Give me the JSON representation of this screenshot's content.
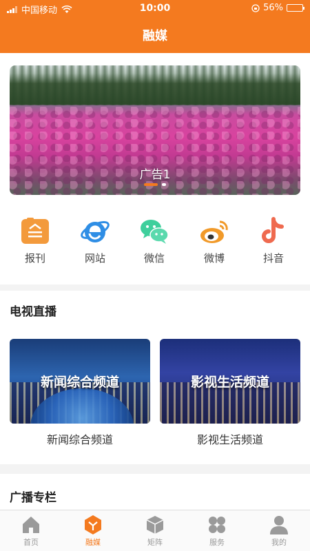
{
  "status_bar": {
    "carrier": "中国移动",
    "time": "10:00",
    "battery": "56%",
    "battery_level": 0.56
  },
  "header": {
    "title": "融媒"
  },
  "banner": {
    "caption": "广告1",
    "slide_count": 2,
    "active_slide": 1
  },
  "shortcuts": [
    {
      "label": "报刊",
      "icon": "newspaper-icon",
      "color": "#f39a3c"
    },
    {
      "label": "网站",
      "icon": "ie-browser-icon",
      "color": "#2f8ee5"
    },
    {
      "label": "微信",
      "icon": "wechat-icon",
      "color": "#3fcf9c"
    },
    {
      "label": "微博",
      "icon": "weibo-icon",
      "color": "#f19a2a"
    },
    {
      "label": "抖音",
      "icon": "douyin-icon",
      "color": "#ef6a4f"
    }
  ],
  "tv_live": {
    "title": "电视直播",
    "channels": [
      {
        "thumb_text": "新闻综合频道",
        "name": "新闻综合频道"
      },
      {
        "thumb_text": "影视生活频道",
        "name": "影视生活频道"
      }
    ]
  },
  "radio": {
    "title": "广播专栏"
  },
  "tabbar": {
    "items": [
      {
        "label": "首页",
        "icon": "home-icon",
        "active": false
      },
      {
        "label": "融媒",
        "icon": "media-hub-icon",
        "active": true
      },
      {
        "label": "矩阵",
        "icon": "cube-icon",
        "active": false
      },
      {
        "label": "服务",
        "icon": "services-grid-icon",
        "active": false
      },
      {
        "label": "我的",
        "icon": "user-icon",
        "active": false
      }
    ]
  },
  "colors": {
    "accent": "#f47a1f",
    "inactive": "#999999"
  }
}
